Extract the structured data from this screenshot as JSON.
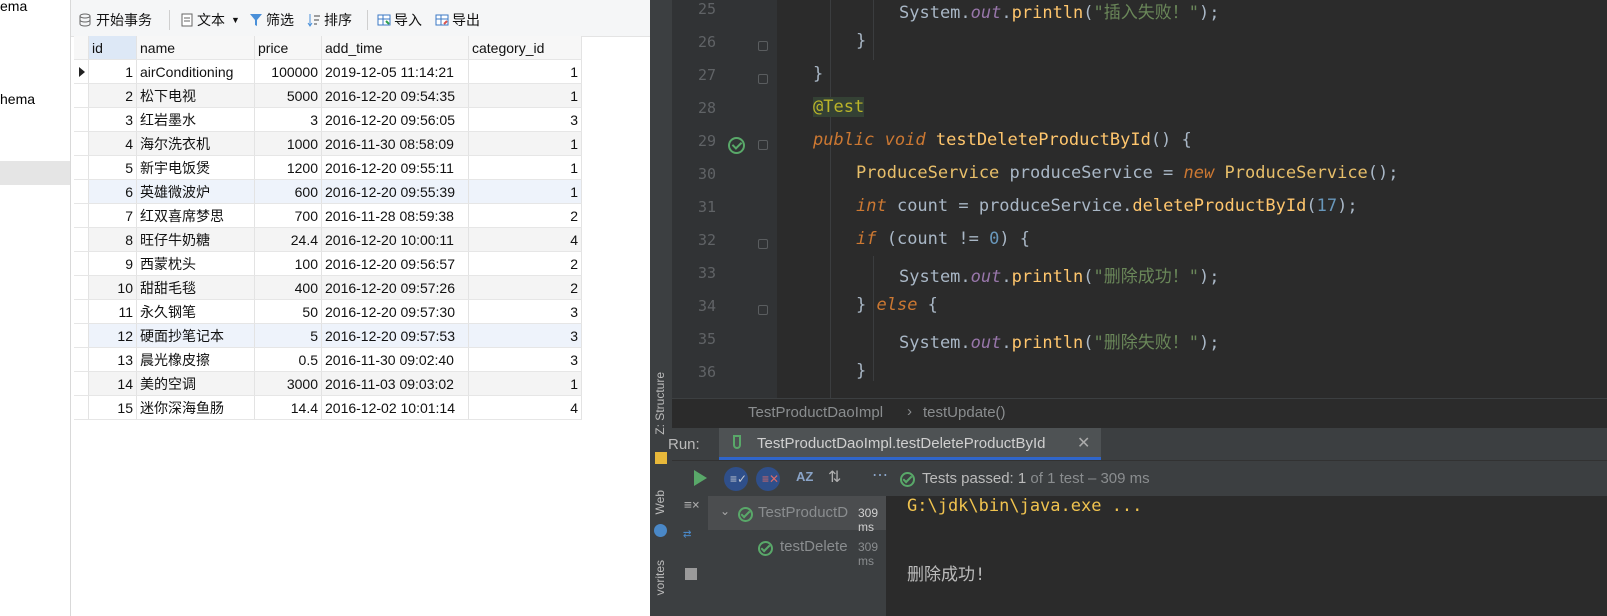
{
  "sidebar": {
    "items": [
      "ema",
      "hema"
    ]
  },
  "db_toolbar": {
    "begin_transaction": "开始事务",
    "text": "文本",
    "filter": "筛选",
    "sort": "排序",
    "import": "导入",
    "export": "导出"
  },
  "table": {
    "columns": [
      "id",
      "name",
      "price",
      "add_time",
      "category_id"
    ],
    "rows": [
      [
        "1",
        "airConditioning",
        "100000",
        "2019-12-05 11:14:21",
        "1"
      ],
      [
        "2",
        "松下电视",
        "5000",
        "2016-12-20 09:54:35",
        "1"
      ],
      [
        "3",
        "红岩墨水",
        "3",
        "2016-12-20 09:56:05",
        "3"
      ],
      [
        "4",
        "海尔洗衣机",
        "1000",
        "2016-11-30 08:58:09",
        "1"
      ],
      [
        "5",
        "新宇电饭煲",
        "1200",
        "2016-12-20 09:55:11",
        "1"
      ],
      [
        "6",
        "英雄微波炉",
        "600",
        "2016-12-20 09:55:39",
        "1"
      ],
      [
        "7",
        "红双喜席梦思",
        "700",
        "2016-11-28 08:59:38",
        "2"
      ],
      [
        "8",
        "旺仔牛奶糖",
        "24.4",
        "2016-12-20 10:00:11",
        "4"
      ],
      [
        "9",
        "西蒙枕头",
        "100",
        "2016-12-20 09:56:57",
        "2"
      ],
      [
        "10",
        "甜甜毛毯",
        "400",
        "2016-12-20 09:57:26",
        "2"
      ],
      [
        "11",
        "永久钢笔",
        "50",
        "2016-12-20 09:57:30",
        "3"
      ],
      [
        "12",
        "硬面抄笔记本",
        "5",
        "2016-12-20 09:57:53",
        "3"
      ],
      [
        "13",
        "晨光橡皮擦",
        "0.5",
        "2016-11-30 09:02:40",
        "3"
      ],
      [
        "14",
        "美的空调",
        "3000",
        "2016-11-03 09:03:02",
        "1"
      ],
      [
        "15",
        "迷你深海鱼肠",
        "14.4",
        "2016-12-02 10:01:14",
        "4"
      ]
    ]
  },
  "editor": {
    "line_numbers": [
      "25",
      "26",
      "27",
      "28",
      "29",
      "30",
      "31",
      "32",
      "33",
      "34",
      "35",
      "36"
    ],
    "lines": [
      {
        "pre": "System.",
        "fld": "out",
        "mid": ".",
        "m": "println",
        "rest1": "(",
        "str": "\"插入失败！\"",
        "rest2": ");"
      },
      {
        "text": "}"
      },
      {
        "text": "}"
      },
      {
        "ann": "@Test"
      },
      {
        "k1": "public",
        "k2": "void",
        "m": "testDeleteProductById",
        "rest": "() {"
      },
      {
        "cls1": "ProduceService",
        "v": " produceService = ",
        "k": "new",
        "cls2": "ProduceService",
        "rest": "();"
      },
      {
        "k": "int",
        "v": " count = produceService.",
        "m": "deleteProductById",
        "p1": "(",
        "num": "17",
        "p2": ");"
      },
      {
        "k": "if",
        "v1": " (count != ",
        "num": "0",
        "v2": ") {"
      },
      {
        "pre": "System.",
        "fld": "out",
        "mid": ".",
        "m": "println",
        "rest1": "(",
        "str": "\"删除成功！\"",
        "rest2": ");"
      },
      {
        "v1": "} ",
        "k": "else",
        "v2": " {"
      },
      {
        "pre": "System.",
        "fld": "out",
        "mid": ".",
        "m": "println",
        "rest1": "(",
        "str": "\"删除失败！\"",
        "rest2": ");"
      },
      {
        "text": "}"
      }
    ]
  },
  "breadcrumb": {
    "class": "TestProductDaoImpl",
    "sep": "›",
    "method": "testUpdate()"
  },
  "tool_windows": {
    "structure": "Z: Structure",
    "web": "Web",
    "favorites": "vorites"
  },
  "run": {
    "label": "Run:",
    "tab_title": "TestProductDaoImpl.testDeleteProductById",
    "tests_passed": "Tests passed:",
    "passed_count": "1",
    "passed_detail": "of 1 test – 309 ms",
    "tree": [
      {
        "name": "TestProductD",
        "time": "309 ms"
      },
      {
        "name": "testDelete",
        "time": "309 ms"
      }
    ],
    "console_lines": [
      "G:\\jdk\\bin\\java.exe ...",
      "删除成功!"
    ]
  },
  "colors": {
    "editor_bg": "#2b2b2b",
    "keyword": "#cc7832",
    "string": "#6a8759",
    "method": "#ffc66d",
    "number": "#6897bb",
    "pass_green": "#59a869",
    "tab_underline": "#2f65ca"
  }
}
